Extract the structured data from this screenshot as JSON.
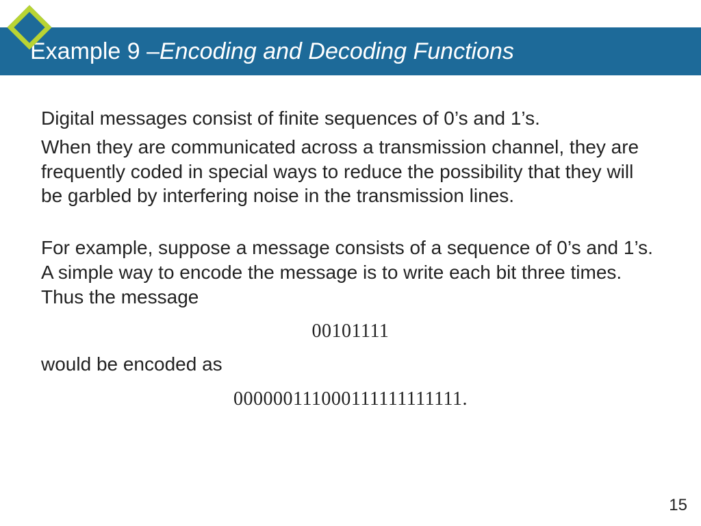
{
  "title": {
    "prefix": "Example 9 – ",
    "subtitle": "Encoding and Decoding Functions"
  },
  "body": {
    "p1": "Digital messages consist of finite sequences of 0’s and 1’s.",
    "p2": "When they are communicated across a transmission channel, they are frequently coded in special ways to reduce the possibility that they will be garbled by interfering noise in the transmission lines.",
    "p3": "For example, suppose a message consists of a sequence of 0’s and 1’s. A simple way to encode the message is to write each bit three times. Thus the message",
    "code1": "00101111",
    "p4": "would be encoded as",
    "code2": "000000111000111111111111."
  },
  "page_number": "15"
}
